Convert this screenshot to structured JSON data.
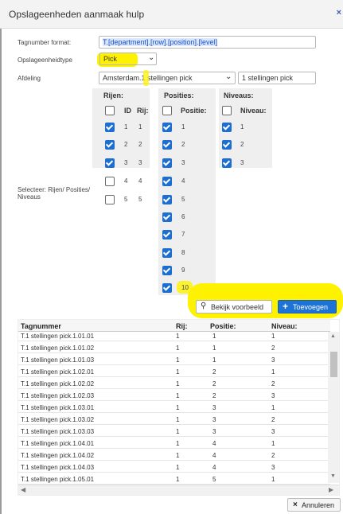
{
  "title": "Opslageenheden aanmaak hulp",
  "close_icon": "×",
  "form": {
    "tagnumber_label": "Tagnumber format:",
    "tagnumber_value": "T.[department].[row].[position].[level]",
    "type_label": "Opslageenheidtype",
    "type_value": "Pick",
    "afdeling_label": "Afdeling",
    "afdeling_value": "Amsterdam.1 stellingen pick",
    "afdeling_extra": "1 stellingen pick",
    "selecteer_label": "Selecteer: Rijen/ Posities/ Niveaus"
  },
  "columns": {
    "rijen": {
      "title": "Rijen:",
      "id_label": "ID",
      "rij_label": "Rij:",
      "items": [
        {
          "id": "1",
          "rij": "1",
          "checked": true
        },
        {
          "id": "2",
          "rij": "2",
          "checked": true
        },
        {
          "id": "3",
          "rij": "3",
          "checked": true
        },
        {
          "id": "4",
          "rij": "4",
          "checked": false
        },
        {
          "id": "5",
          "rij": "5",
          "checked": false
        }
      ]
    },
    "posities": {
      "title": "Posities:",
      "positie_label": "Positie:",
      "items": [
        {
          "value": "1",
          "checked": true
        },
        {
          "value": "2",
          "checked": true
        },
        {
          "value": "3",
          "checked": true
        },
        {
          "value": "4",
          "checked": true
        },
        {
          "value": "5",
          "checked": true
        },
        {
          "value": "6",
          "checked": true
        },
        {
          "value": "7",
          "checked": true
        },
        {
          "value": "8",
          "checked": true
        },
        {
          "value": "9",
          "checked": true
        },
        {
          "value": "10",
          "checked": true
        }
      ]
    },
    "niveaus": {
      "title": "Niveaus:",
      "niveau_label": "Niveau:",
      "items": [
        {
          "value": "1",
          "checked": true
        },
        {
          "value": "2",
          "checked": true
        },
        {
          "value": "3",
          "checked": true
        }
      ]
    }
  },
  "buttons": {
    "preview": "Bekijk voorbeeld",
    "add": "Toevoegen",
    "cancel": "Annuleren"
  },
  "table": {
    "headers": [
      "Tagnummer",
      "Rij:",
      "Positie:",
      "Niveau:"
    ],
    "rows": [
      [
        "T.1 stellingen pick.1.01.01",
        "1",
        "1",
        "1"
      ],
      [
        "T.1 stellingen pick.1.01.02",
        "1",
        "1",
        "2"
      ],
      [
        "T.1 stellingen pick.1.01.03",
        "1",
        "1",
        "3"
      ],
      [
        "T.1 stellingen pick.1.02.01",
        "1",
        "2",
        "1"
      ],
      [
        "T.1 stellingen pick.1.02.02",
        "1",
        "2",
        "2"
      ],
      [
        "T.1 stellingen pick.1.02.03",
        "1",
        "2",
        "3"
      ],
      [
        "T.1 stellingen pick.1.03.01",
        "1",
        "3",
        "1"
      ],
      [
        "T.1 stellingen pick.1.03.02",
        "1",
        "3",
        "2"
      ],
      [
        "T.1 stellingen pick.1.03.03",
        "1",
        "3",
        "3"
      ],
      [
        "T.1 stellingen pick.1.04.01",
        "1",
        "4",
        "1"
      ],
      [
        "T.1 stellingen pick.1.04.02",
        "1",
        "4",
        "2"
      ],
      [
        "T.1 stellingen pick.1.04.03",
        "1",
        "4",
        "3"
      ],
      [
        "T.1 stellingen pick.1.05.01",
        "1",
        "5",
        "1"
      ]
    ]
  },
  "colors": {
    "highlight": "#fff200",
    "checkbox": "#1c6fd1",
    "primary_button": "#1e73d6"
  }
}
